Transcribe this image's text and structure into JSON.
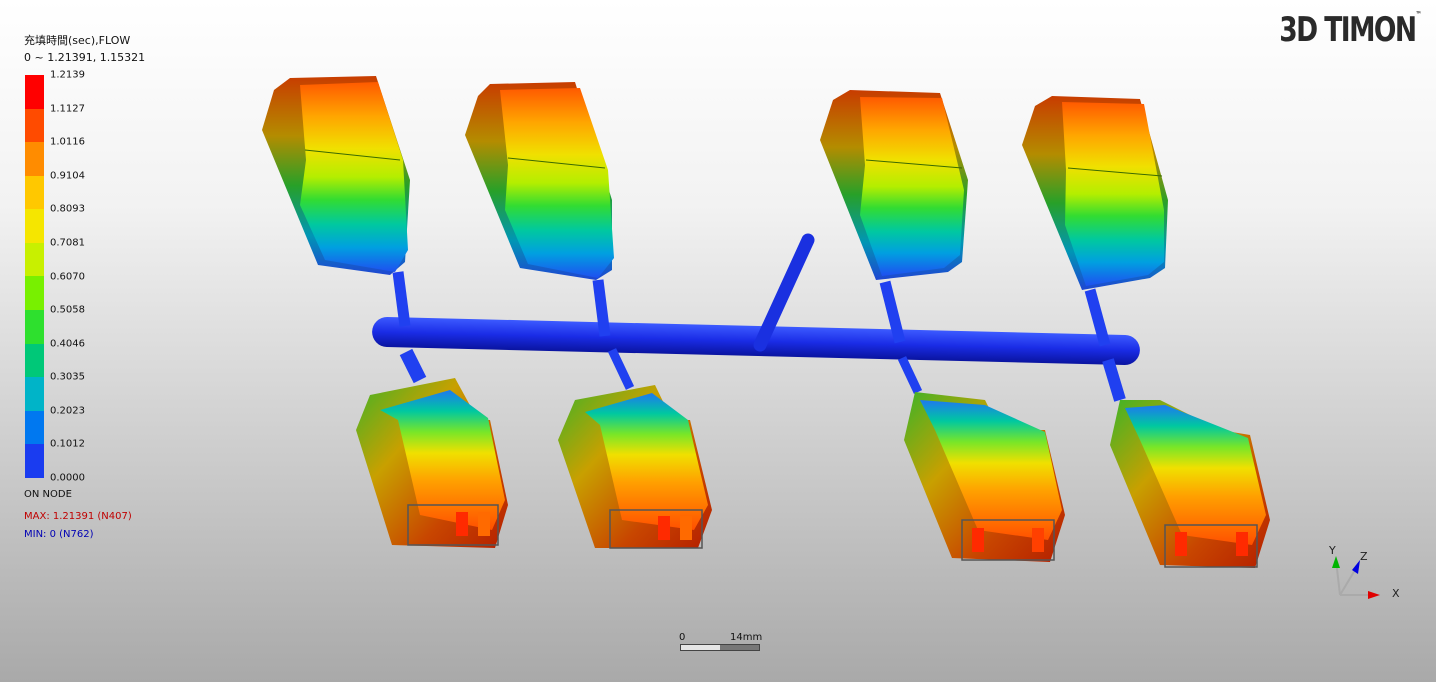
{
  "legend": {
    "title": "充填時間(sec),FLOW",
    "range": "0 ~ 1.21391, 1.15321",
    "ticks": [
      "1.2139",
      "1.1127",
      "1.0116",
      "0.9104",
      "0.8093",
      "0.7081",
      "0.6070",
      "0.5058",
      "0.4046",
      "0.3035",
      "0.2023",
      "0.1012",
      "0.0000"
    ],
    "colors": [
      "#ff0000",
      "#ff4b00",
      "#ff8c00",
      "#ffc800",
      "#f5e600",
      "#c8f000",
      "#78f000",
      "#2ee02e",
      "#00c878",
      "#00b4c8",
      "#0078f0",
      "#1a3cf0",
      "#0000f0"
    ],
    "on_node": "ON NODE",
    "max": "MAX: 1.21391 (N407)",
    "min": "MIN: 0 (N762)",
    "max_color": "#c00000",
    "min_color": "#0000b4"
  },
  "brand": {
    "name": "3D TIMON",
    "tm": "™"
  },
  "scale": {
    "zero": "0",
    "length": "14mm"
  },
  "axes": {
    "x": "X",
    "y": "Y",
    "z": "Z"
  }
}
